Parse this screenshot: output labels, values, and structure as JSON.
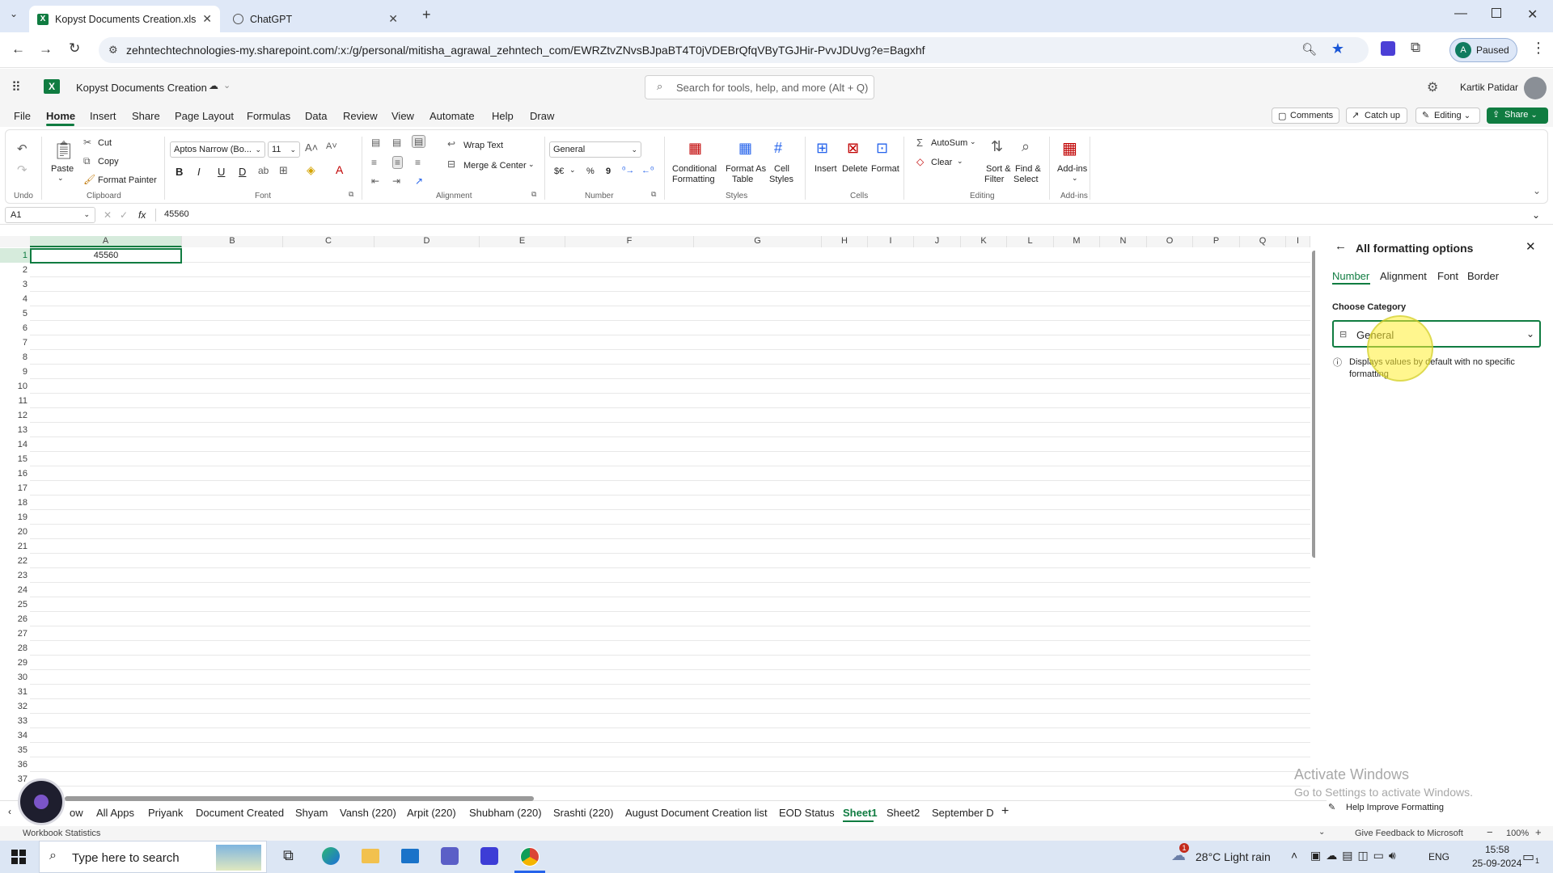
{
  "browser": {
    "tabs": [
      {
        "title": "Kopyst Documents Creation.xls"
      },
      {
        "title": "ChatGPT"
      }
    ],
    "url": "zehntechtechnologies-my.sharepoint.com/:x:/g/personal/mitisha_agrawal_zehntech_com/EWRZtvZNvsBJpaBT4T0jVDEBrQfqVByTGJHir-PvvJDUvg?e=Bagxhf",
    "profile_initial": "A",
    "profile_status": "Paused"
  },
  "excel": {
    "doc_title": "Kopyst Documents Creation",
    "search_placeholder": "Search for tools, help, and more (Alt + Q)",
    "user_name": "Kartik Patidar",
    "menus": [
      "File",
      "Home",
      "Insert",
      "Share",
      "Page Layout",
      "Formulas",
      "Data",
      "Review",
      "View",
      "Automate",
      "Help",
      "Draw"
    ],
    "active_menu": "Home",
    "actions": {
      "comments": "Comments",
      "catch_up": "Catch up",
      "editing": "Editing",
      "share": "Share"
    },
    "ribbon": {
      "undo_group": "Undo",
      "clipboard": {
        "paste": "Paste",
        "cut": "Cut",
        "copy": "Copy",
        "format_painter": "Format Painter",
        "group": "Clipboard"
      },
      "font": {
        "name": "Aptos Narrow (Bo...",
        "size": "11",
        "group": "Font",
        "b": "B",
        "i": "I",
        "u": "U",
        "d": "D"
      },
      "alignment": {
        "wrap": "Wrap Text",
        "merge": "Merge & Center",
        "group": "Alignment"
      },
      "number": {
        "format": "General",
        "currency": "$€",
        "percent": "%",
        "comma": "9",
        "group": "Number"
      },
      "styles": {
        "conditional_1": "Conditional",
        "conditional_2": "Formatting",
        "format_table_1": "Format As",
        "format_table_2": "Table",
        "cell_styles_1": "Cell",
        "cell_styles_2": "Styles",
        "group": "Styles"
      },
      "cells": {
        "insert": "Insert",
        "delete": "Delete",
        "format": "Format",
        "group": "Cells"
      },
      "editing": {
        "autosum": "AutoSum",
        "clear": "Clear",
        "sort_1": "Sort &",
        "sort_2": "Filter",
        "find_1": "Find &",
        "find_2": "Select",
        "group": "Editing"
      },
      "addins": {
        "label": "Add-ins",
        "group": "Add-ins"
      }
    },
    "name_box": "A1",
    "fx": "fx",
    "formula": "45560",
    "columns": [
      "A",
      "B",
      "C",
      "D",
      "E",
      "F",
      "G",
      "H",
      "I",
      "J",
      "K",
      "L",
      "M",
      "N",
      "O",
      "P",
      "Q",
      "I"
    ],
    "cell_a1": "45560",
    "panel": {
      "title": "All formatting options",
      "tabs": [
        "Number",
        "Alignment",
        "Font",
        "Border"
      ],
      "active_tab": "Number",
      "category_label": "Choose Category",
      "category_value": "General",
      "description": "Displays values by default with no specific formatting",
      "help": "Help Improve Formatting"
    },
    "sheets": [
      "All Apps",
      "Priyank",
      "Document Created",
      "Shyam",
      "Vansh (220)",
      "Arpit (220)",
      "Shubham (220)",
      "Srashti (220)",
      "August Document Creation list",
      "EOD Status",
      "Sheet1",
      "Sheet2",
      "September D"
    ],
    "sheet_prefix": "ow",
    "active_sheet": "Sheet1",
    "status_left": "Workbook Statistics",
    "feedback": "Give Feedback to Microsoft",
    "zoom": "100%",
    "watermark_title": "Activate Windows",
    "watermark_sub": "Go to Settings to activate Windows."
  },
  "taskbar": {
    "search_placeholder": "Type here to search",
    "weather": "28°C  Light rain",
    "lang": "ENG",
    "time": "15:58",
    "date": "25-09-2024",
    "weather_badge": "1",
    "notif_count": "1"
  }
}
